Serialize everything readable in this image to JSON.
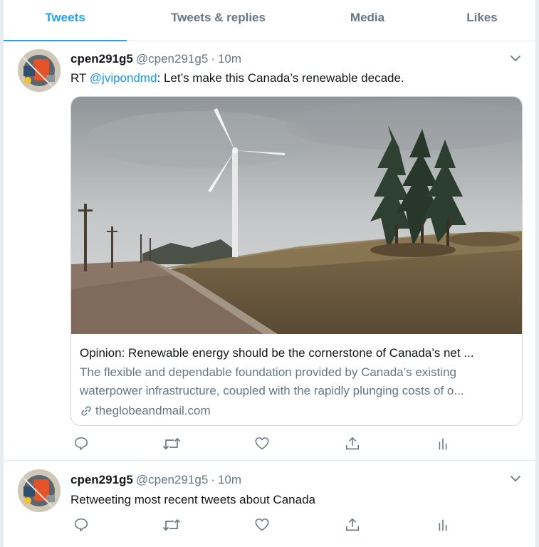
{
  "tabs": [
    {
      "label": "Tweets",
      "active": true
    },
    {
      "label": "Tweets & replies",
      "active": false
    },
    {
      "label": "Media",
      "active": false
    },
    {
      "label": "Likes",
      "active": false
    }
  ],
  "colors": {
    "accent": "#1da1f2",
    "link": "#1b95e0",
    "muted": "#657786",
    "border": "#e6ecf0"
  },
  "tweets": [
    {
      "name": "cpen291g5",
      "handle": "@cpen291g5",
      "separator": "·",
      "time": "10m",
      "text_prefix": "RT ",
      "mention": "@jvipondmd",
      "text_rest": ": Let’s make this Canada’s renewable decade.",
      "card": {
        "title": "Opinion: Renewable energy should be the cornerstone of Canada’s net ...",
        "desc_line1": "The flexible and dependable foundation provided by Canada’s existing",
        "desc_line2": "waterpower infrastructure, coupled with the rapidly plunging costs of o...",
        "domain": "theglobeandmail.com",
        "image_icon": "wind-turbine-photo"
      }
    },
    {
      "name": "cpen291g5",
      "handle": "@cpen291g5",
      "separator": "·",
      "time": "10m",
      "text": "Retweeting most recent tweets about Canada"
    }
  ],
  "actions": [
    "reply-icon",
    "retweet-icon",
    "like-icon",
    "share-icon",
    "analytics-icon"
  ]
}
